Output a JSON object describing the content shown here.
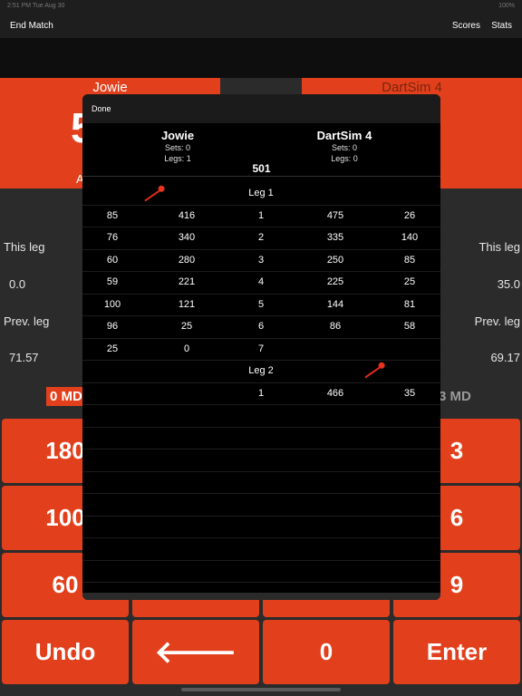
{
  "status": {
    "left": "2:51 PM   Tue Aug 30",
    "right": "100%"
  },
  "nav": {
    "end_match": "End Match",
    "scores": "Scores",
    "stats": "Stats"
  },
  "background": {
    "left_player": "Jowie",
    "left_score_partial": "5",
    "left_avg_partial": "A",
    "right_player": "DartSim 4",
    "right_score_partial": "6",
    "this_leg": "This leg",
    "prev_leg": "Prev. leg",
    "left_this_leg": "0.0",
    "right_this_leg": "35.0",
    "left_prev_leg": "71.57",
    "right_prev_leg": "69.17",
    "left_md": "0 MD",
    "right_md": "3 MD"
  },
  "keypad": {
    "k180": "180",
    "k100": "100",
    "k60": "60",
    "k3": "3",
    "k6": "6",
    "k9": "9",
    "undo": "Undo",
    "back": "🡐",
    "zero": "0",
    "enter": "Enter"
  },
  "modal": {
    "done": "Done",
    "p1": {
      "name": "Jowie",
      "sets": "Sets: 0",
      "legs": "Legs: 1"
    },
    "p2": {
      "name": "DartSim 4",
      "sets": "Sets: 0",
      "legs": "Legs: 0"
    },
    "start": "501",
    "legs": [
      {
        "title": "Leg 1",
        "rows": [
          {
            "p1_scored": "85",
            "p1_left": "416",
            "turn": "1",
            "p2_left": "475",
            "p2_scored": "26"
          },
          {
            "p1_scored": "76",
            "p1_left": "340",
            "turn": "2",
            "p2_left": "335",
            "p2_scored": "140"
          },
          {
            "p1_scored": "60",
            "p1_left": "280",
            "turn": "3",
            "p2_left": "250",
            "p2_scored": "85"
          },
          {
            "p1_scored": "59",
            "p1_left": "221",
            "turn": "4",
            "p2_left": "225",
            "p2_scored": "25"
          },
          {
            "p1_scored": "100",
            "p1_left": "121",
            "turn": "5",
            "p2_left": "144",
            "p2_scored": "81"
          },
          {
            "p1_scored": "96",
            "p1_left": "25",
            "turn": "6",
            "p2_left": "86",
            "p2_scored": "58"
          },
          {
            "p1_scored": "25",
            "p1_left": "0",
            "turn": "7",
            "p2_left": "",
            "p2_scored": ""
          }
        ]
      },
      {
        "title": "Leg 2",
        "rows": [
          {
            "p1_scored": "",
            "p1_left": "",
            "turn": "1",
            "p2_left": "466",
            "p2_scored": "35"
          }
        ]
      }
    ]
  },
  "colors": {
    "accent": "#e2401c",
    "modal_bg": "#000000",
    "dart": "#d8291b"
  }
}
